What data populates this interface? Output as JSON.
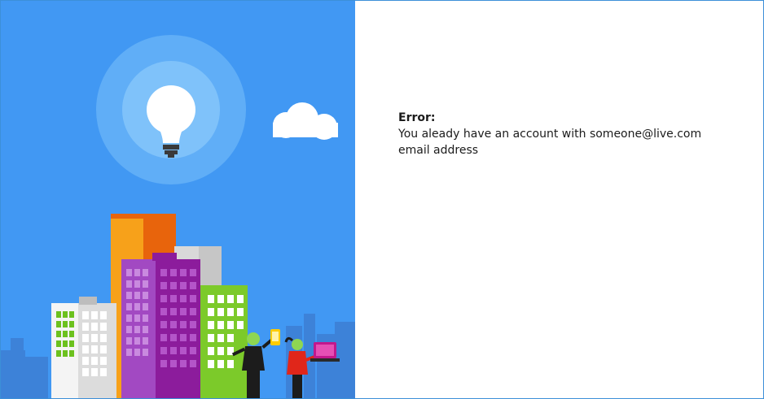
{
  "error": {
    "title": "Error:",
    "message": "You aleady have an account with someone@live.com email address"
  },
  "illustration": {
    "background_color": "#4198f3",
    "icons": [
      "lightbulb-icon",
      "cloud-icon",
      "city-buildings",
      "people-with-devices"
    ]
  }
}
